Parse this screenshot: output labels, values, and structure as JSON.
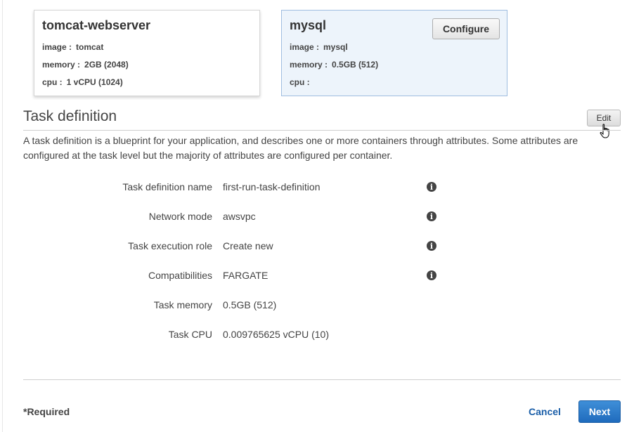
{
  "containers": [
    {
      "name": "tomcat-webserver",
      "image_label": "image :",
      "image_value": "tomcat",
      "memory_label": "memory :",
      "memory_value": "2GB (2048)",
      "cpu_label": "cpu :",
      "cpu_value": "1 vCPU (1024)"
    },
    {
      "name": "mysql",
      "image_label": "image :",
      "image_value": "mysql",
      "memory_label": "memory :",
      "memory_value": "0.5GB (512)",
      "cpu_label": "cpu :",
      "cpu_value": "",
      "configure_label": "Configure"
    }
  ],
  "task_definition": {
    "title": "Task definition",
    "edit_label": "Edit",
    "description": "A task definition is a blueprint for your application, and describes one or more containers through attributes. Some attributes are configured at the task level but the majority of attributes are configured per container.",
    "rows": [
      {
        "label": "Task definition name",
        "value": "first-run-task-definition",
        "info_icon": "info-icon"
      },
      {
        "label": "Network mode",
        "value": "awsvpc",
        "info_icon": "info-icon"
      },
      {
        "label": "Task execution role",
        "value": "Create new",
        "info_icon": "info-icon"
      },
      {
        "label": "Compatibilities",
        "value": "FARGATE",
        "info_icon": "info-icon"
      },
      {
        "label": "Task memory",
        "value": "0.5GB (512)"
      },
      {
        "label": "Task CPU",
        "value": "0.009765625 vCPU (10)"
      }
    ]
  },
  "footer": {
    "required_label": "*Required",
    "cancel_label": "Cancel",
    "next_label": "Next"
  },
  "colors": {
    "selected_card_bg": "#edf4fb",
    "selected_card_border": "#9fbde0",
    "primary_button": "#1f6bbd",
    "link": "#1a5ea8"
  }
}
